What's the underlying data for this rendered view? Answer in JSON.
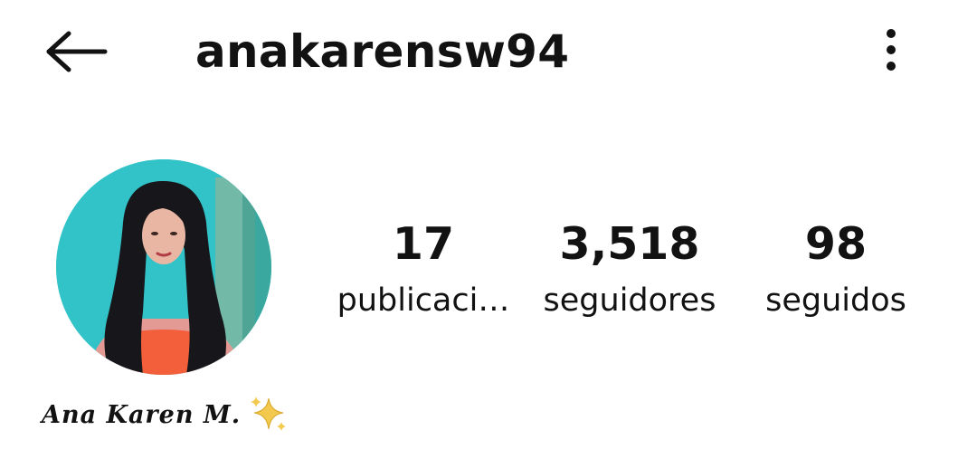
{
  "header": {
    "username": "anakarensw94",
    "back_icon": "arrow-left-icon",
    "menu_icon": "more-vertical-icon"
  },
  "profile": {
    "avatar_icon": "profile-photo",
    "stats": {
      "posts": {
        "count": "17",
        "label": "publicaci…"
      },
      "followers": {
        "count": "3,518",
        "label": "seguidores"
      },
      "following": {
        "count": "98",
        "label": "seguidos"
      }
    },
    "display_name": "Ana Karen M.",
    "display_name_emoji": "sparkles-icon"
  },
  "colors": {
    "text": "#121212",
    "background": "#ffffff",
    "sparkle": "#f2c94c",
    "avatar_background": "#2fbfc4",
    "avatar_top": "#e39a95",
    "hair": "#17161a"
  }
}
